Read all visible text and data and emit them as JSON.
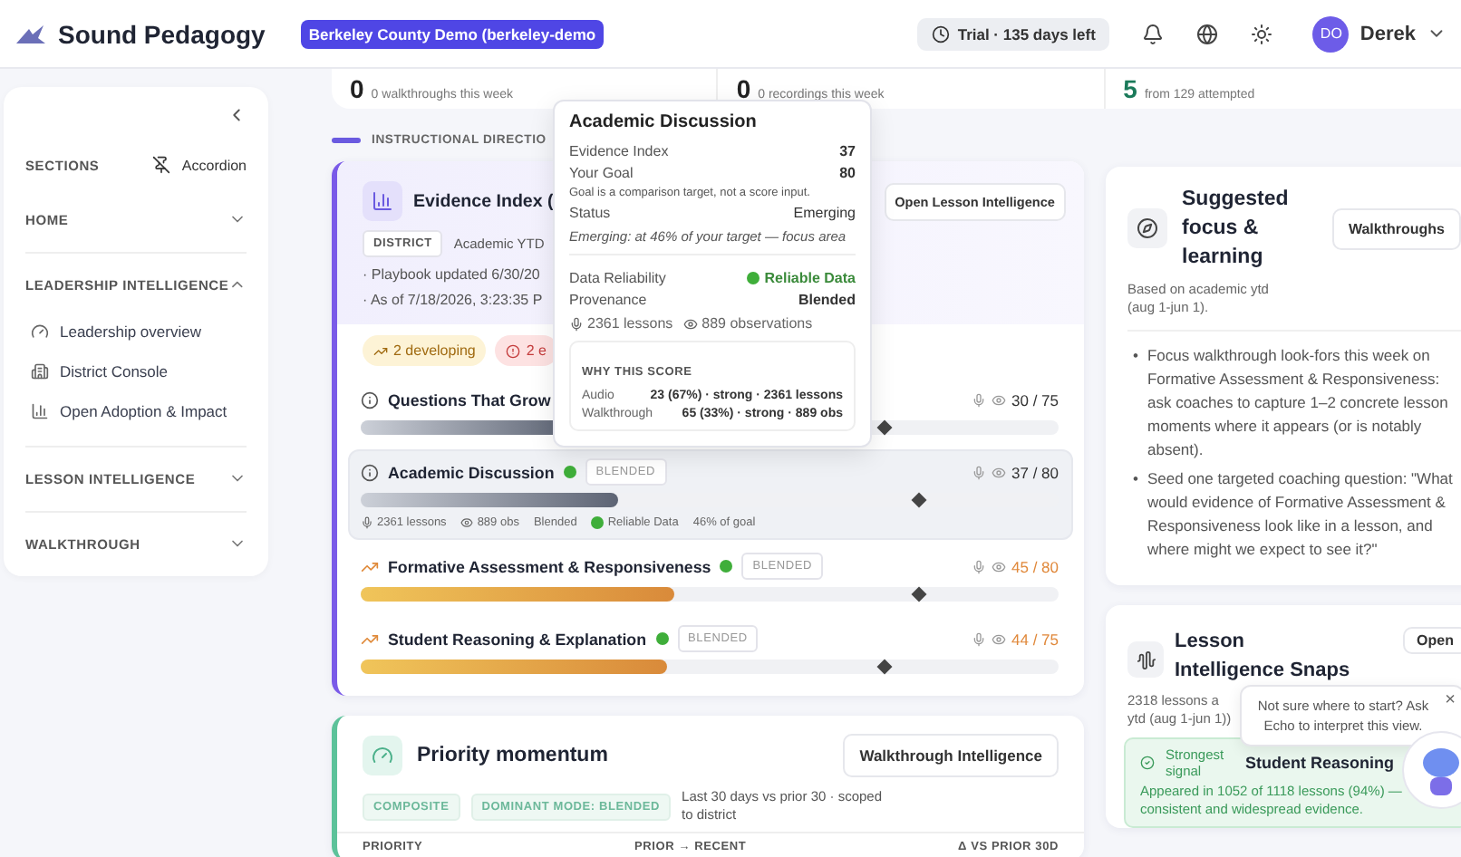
{
  "header": {
    "brand": "Sound Pedagogy",
    "tenant": "Berkeley County Demo (berkeley-demo",
    "trial": "Trial · 135 days left",
    "user": {
      "initials": "DO",
      "name": "Derek"
    }
  },
  "stats": [
    {
      "value": "0",
      "caption": "0 walkthroughs this week"
    },
    {
      "value": "0",
      "caption": "0 recordings this week"
    },
    {
      "value": "5",
      "caption": "from 129 attempted"
    }
  ],
  "sidebar": {
    "heading": "SECTIONS",
    "mode": "Accordion",
    "groups": [
      {
        "label": "HOME",
        "expanded": false
      },
      {
        "label": "LEADERSHIP INTELLIGENCE",
        "expanded": true,
        "items": [
          "Leadership overview",
          "District Console",
          "Open Adoption & Impact"
        ]
      },
      {
        "label": "LESSON INTELLIGENCE",
        "expanded": false
      },
      {
        "label": "WALKTHROUGH",
        "expanded": false
      }
    ]
  },
  "section_label": "INSTRUCTIONAL DIRECTIO",
  "evidence": {
    "title": "Evidence Index (",
    "button": "Open Lesson Intelligence",
    "scope_tag": "DISTRICT",
    "scope": "Academic YTD",
    "meta": [
      "· Playbook updated 6/30/20",
      "· As of 7/18/2026, 3:23:35 P"
    ],
    "chips": [
      {
        "kind": "developing",
        "label": "2 developing"
      },
      {
        "kind": "alert",
        "label": "2 e"
      }
    ],
    "practices": [
      {
        "name": "Questions That Grow",
        "kind": "emerging",
        "score": "30 / 75",
        "level": 0.3,
        "goal": {
          "level": 0.75
        },
        "selected": false
      },
      {
        "name": "Academic Discussion",
        "kind": "emerging",
        "reliable": true,
        "tag": "BLENDED",
        "score": "37 / 80",
        "level": 0.37,
        "goal": {
          "level": 0.8
        },
        "selected": true,
        "details": [
          "2361 lessons",
          "889 obs",
          "Blended",
          "Reliable Data",
          "46% of goal"
        ]
      },
      {
        "name": "Formative Assessment & Responsiveness",
        "kind": "developing",
        "reliable": true,
        "tag": "BLENDED",
        "score": "45 / 80",
        "level": 0.45,
        "goal": {
          "level": 0.8
        },
        "selected": false
      },
      {
        "name": "Student Reasoning & Explanation",
        "kind": "developing",
        "reliable": true,
        "tag": "BLENDED",
        "score": "44 / 75",
        "level": 0.44,
        "goal": {
          "level": 0.75
        },
        "selected": false
      }
    ]
  },
  "tooltip": {
    "title": "Academic Discussion",
    "rows": [
      {
        "label": "Evidence Index",
        "value": "37"
      },
      {
        "label": "Your Goal",
        "value": "80"
      }
    ],
    "note": "Goal is a comparison target, not a score input.",
    "status": {
      "label": "Status",
      "value": "Emerging"
    },
    "summary": "Emerging: at 46% of your target — focus area",
    "reliability": {
      "label": "Data Reliability",
      "value": "Reliable Data"
    },
    "provenance": {
      "label": "Provenance",
      "value": "Blended"
    },
    "counts": [
      "2361 lessons",
      "889 observations"
    ],
    "why": {
      "heading": "WHY THIS SCORE",
      "rows": [
        {
          "source": "Audio",
          "detail": "23 (67%) · strong · 2361 lessons"
        },
        {
          "source": "Walkthrough",
          "detail": "65 (33%) · strong · 889 obs"
        }
      ]
    }
  },
  "priority": {
    "title": "Priority momentum",
    "button": "Walkthrough Intelligence",
    "tags": [
      "COMPOSITE",
      "DOMINANT MODE: BLENDED"
    ],
    "note": "Last 30 days vs prior 30 · scoped to district",
    "columns": [
      "PRIORITY",
      "PRIOR → RECENT",
      "Δ VS PRIOR 30D"
    ]
  },
  "focus": {
    "title": "Suggested focus & learning",
    "button": "Walkthroughs",
    "marker": "•",
    "subtitle": "Based on academic ytd (aug 1-jun 1).",
    "bullets": [
      "Focus walkthrough look-fors this week on Formative Assessment & Responsiveness: ask coaches to capture 1–2 concrete lesson moments where it appears (or is notably absent).",
      "Seed one targeted coaching question: \"What would evidence of Formative Assessment & Responsiveness look like in a lesson, and where might we expect to see it?\""
    ]
  },
  "snapshot": {
    "title": "Lesson Intelligence Snaps",
    "button": "Open",
    "subtitle": [
      "2318 lessons a",
      "ytd (aug 1-jun 1))"
    ],
    "signal": {
      "label": "Strongest signal",
      "name": "Student Reasoning",
      "text": "Appeared in 1052 of 1118 lessons (94%) — consistent and widespread evidence."
    }
  },
  "echo": {
    "message": "Not sure where to start? Ask Echo to interpret this view.",
    "close": "×"
  }
}
